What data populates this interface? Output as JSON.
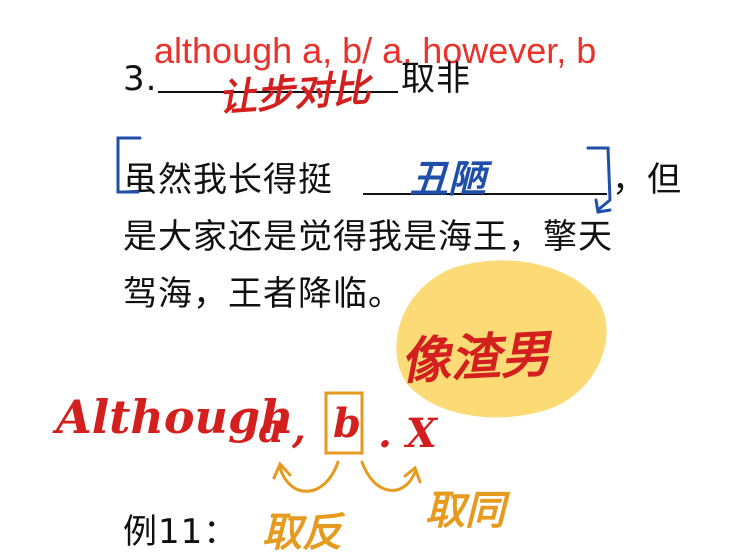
{
  "colors": {
    "typed_red": "#e8322b",
    "ink_red": "#d41f1f",
    "ink_blue": "#1f4fa8",
    "ink_orange": "#e69a1e",
    "highlight_yellow": "#fbd35e"
  },
  "header_annotation": "although a,   b/ a,   however,   b",
  "question": {
    "number": "3.",
    "suffix": "取非",
    "blank_note": "让步对比"
  },
  "sentence": {
    "line1_before": "虽然我长得挺",
    "line1_after": "，但",
    "blank_note": "丑陋",
    "line2": "是大家还是觉得我是海王，擎天",
    "line3": "驾海，王者降临。"
  },
  "highlight_note": "像渣男",
  "formula": {
    "lead": "Although",
    "a": "a",
    "comma": ",",
    "b": "b",
    "x": ". X",
    "left_note": "取反",
    "right_note": "取同"
  },
  "example_label": "例11："
}
